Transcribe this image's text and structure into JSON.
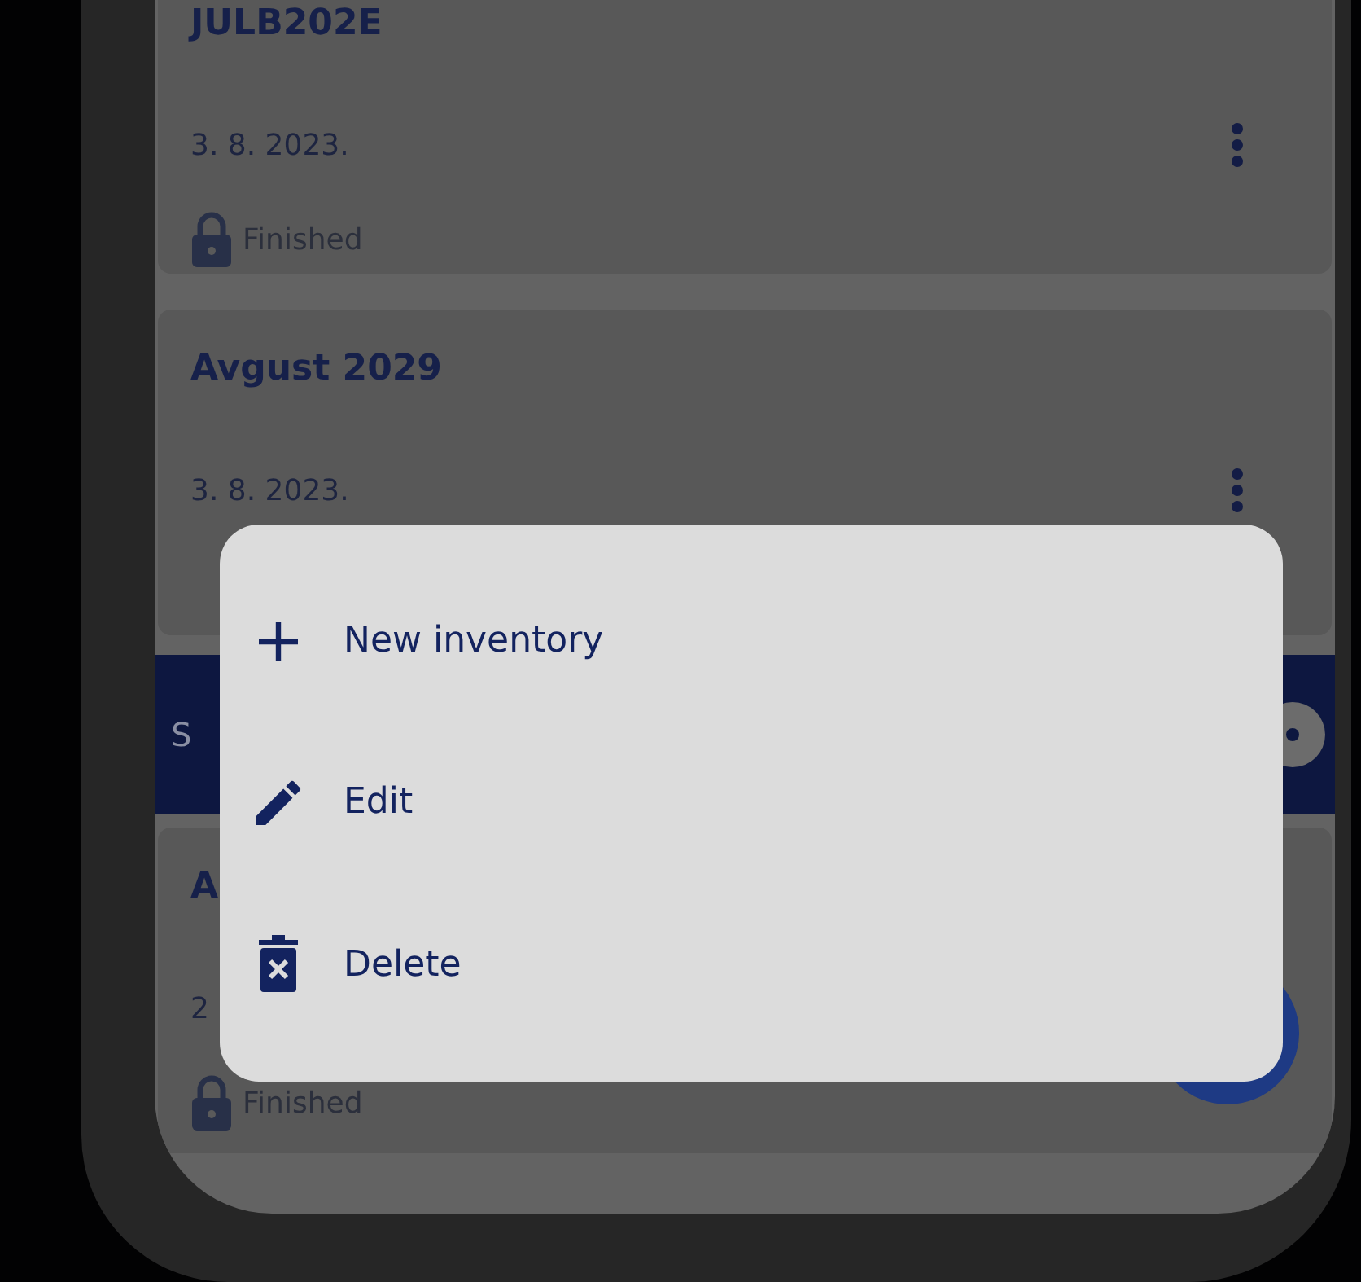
{
  "inventories": [
    {
      "title": "JULB202E",
      "date": "3. 8. 2023.",
      "status": "Finished",
      "locked": true,
      "menu": true
    },
    {
      "title": "Avgust 2029",
      "date": "3. 8. 2023.",
      "menu": true
    },
    {
      "kind": "bar",
      "title": "S"
    },
    {
      "title": "A",
      "date": "2",
      "status": "Finished",
      "locked": true
    }
  ],
  "context_menu": [
    {
      "kind": "add",
      "label": "New inventory"
    },
    {
      "kind": "edit",
      "label": "Edit"
    },
    {
      "kind": "delete",
      "label": "Delete"
    }
  ]
}
